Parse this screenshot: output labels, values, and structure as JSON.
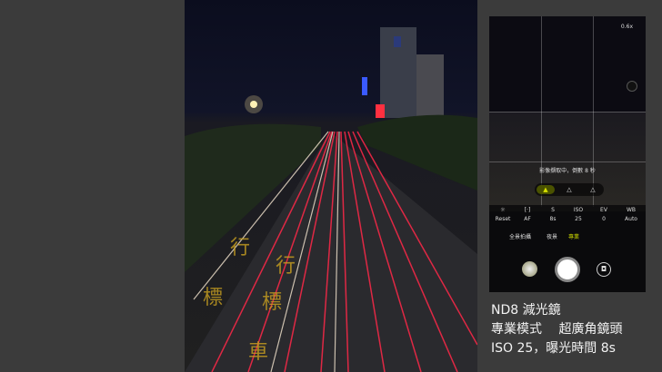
{
  "phone": {
    "zoom_level": "0.6x",
    "status_text": "影像擷取中，倒數 8 秒",
    "countdown_accent": "#c8d400",
    "settings": [
      {
        "label": "Reset",
        "icon": "reset-icon"
      },
      {
        "label": "AF",
        "value": "",
        "icon": "focus-icon"
      },
      {
        "label": "S",
        "value": "8s"
      },
      {
        "label": "ISO",
        "value": "25"
      },
      {
        "label": "EV",
        "value": "0"
      },
      {
        "label": "WB",
        "value": "Auto"
      }
    ],
    "modes": [
      "全景拍攝",
      "夜景",
      "專業"
    ],
    "active_mode": "專業"
  },
  "caption": {
    "line1": "ND8 減光鏡",
    "line2": "專業模式　 超廣角鏡頭",
    "line3": "ISO 25，曝光時間 8s"
  }
}
